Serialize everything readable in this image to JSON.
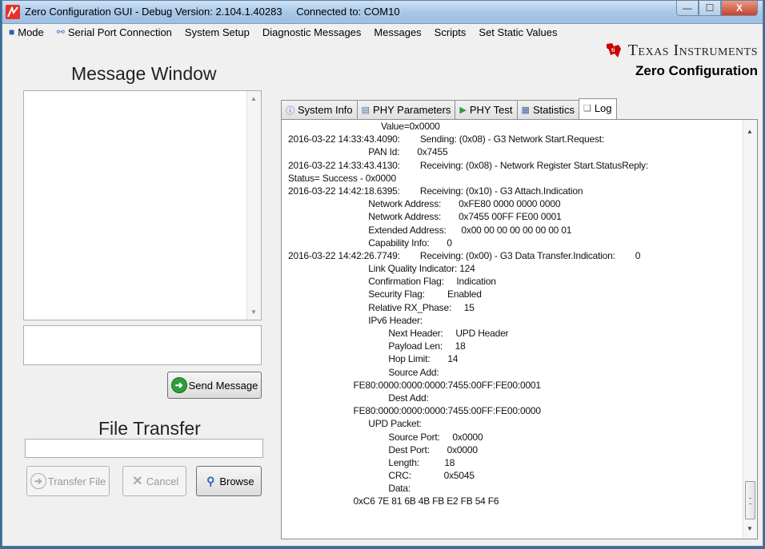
{
  "window": {
    "title": "Zero Configuration GUI - Debug Version: 2.104.1.40283",
    "connection": "Connected to: COM10",
    "buttons": {
      "minimize": "—",
      "maximize": "☐",
      "close": "X"
    }
  },
  "menu": [
    {
      "label": "Mode",
      "icon": "mode-icon"
    },
    {
      "label": "Serial Port Connection",
      "icon": "plug-icon"
    },
    {
      "label": "System Setup"
    },
    {
      "label": "Diagnostic Messages"
    },
    {
      "label": "Messages"
    },
    {
      "label": "Scripts"
    },
    {
      "label": "Set Static Values"
    }
  ],
  "brand": {
    "company": "Texas Instruments",
    "subtitle": "Zero Configuration",
    "logo_icon": "ti-logo-icon"
  },
  "left": {
    "message_window_title": "Message Window",
    "message_input_value": "",
    "send_button": "Send Message",
    "file_transfer_title": "File Transfer",
    "file_path_value": "",
    "transfer_button": "Transfer File",
    "cancel_button": "Cancel",
    "browse_button": "Browse"
  },
  "tabs": [
    {
      "label": "System Info",
      "icon": "info-icon"
    },
    {
      "label": "PHY Parameters",
      "icon": "document-icon"
    },
    {
      "label": "PHY Test",
      "icon": "play-icon"
    },
    {
      "label": "Statistics",
      "icon": "table-icon"
    },
    {
      "label": "Log",
      "icon": "log-icon",
      "active": true
    }
  ],
  "log_lines": [
    "                                     Value=0x0000",
    "2016-03-22 14:33:43.4090:        Sending: (0x08) - G3 Network Start.Request:",
    "                                PAN Id:       0x7455",
    "2016-03-22 14:33:43.4130:        Receiving: (0x08) - Network Register Start.StatusReply:",
    "Status= Success - 0x0000",
    "2016-03-22 14:42:18.6395:        Receiving: (0x10) - G3 Attach.Indication",
    "                                Network Address:       0xFE80 0000 0000 0000",
    "                                Network Address:       0x7455 00FF FE00 0001",
    "                                Extended Address:      0x00 00 00 00 00 00 00 01",
    "                                Capability Info:       0",
    "2016-03-22 14:42:26.7749:        Receiving: (0x00) - G3 Data Transfer.Indication:        0",
    "                                Link Quality Indicator: 124",
    "                                Confirmation Flag:     Indication",
    "                                Security Flag:         Enabled",
    "                                Relative RX_Phase:     15",
    "                                IPv6 Header:",
    "                                        Next Header:     UPD Header",
    "                                        Payload Len:     18",
    "                                        Hop Limit:       14",
    "                                        Source Add:",
    "                          FE80:0000:0000:0000:7455:00FF:FE00:0001",
    "                                        Dest Add:",
    "                          FE80:0000:0000:0000:7455:00FF:FE00:0000",
    "                                UPD Packet:",
    "                                        Source Port:     0x0000",
    "                                        Dest Port:       0x0000",
    "                                        Length:          18",
    "                                        CRC:             0x5045",
    "                                        Data:",
    "                          0xC6 7E 81 6B 4B FB E2 FB 54 F6"
  ]
}
